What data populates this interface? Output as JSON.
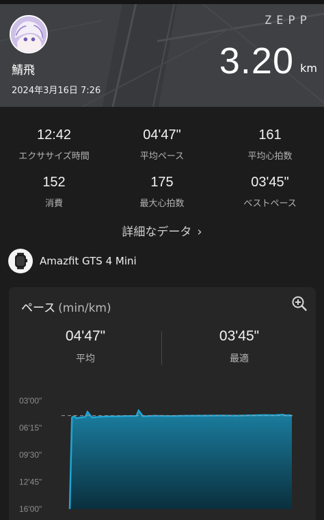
{
  "header": {
    "brand": "ZEPP",
    "username": "鯖飛",
    "datetime": "2024年3月16日 7:26",
    "distance_value": "3.20",
    "distance_unit": "km"
  },
  "stats": [
    {
      "value": "12:42",
      "label": "エクササイズ時間"
    },
    {
      "value": "04'47\"",
      "label": "平均ペース"
    },
    {
      "value": "161",
      "label": "平均心拍数"
    },
    {
      "value": "152",
      "label": "消費"
    },
    {
      "value": "175",
      "label": "最大心拍数"
    },
    {
      "value": "03'45\"",
      "label": "ベストペース"
    }
  ],
  "details_link": "詳細なデータ",
  "device": {
    "name": "Amazfit GTS 4 Mini"
  },
  "pace_card": {
    "title": "ペース",
    "unit": "(min/km)",
    "average_value": "04'47\"",
    "average_label": "平均",
    "best_value": "03'45\"",
    "best_label": "最適"
  },
  "colors": {
    "accent": "#1fa6d6",
    "area_top": "#1b7fa1",
    "area_bottom": "#0a2f3d",
    "background": "#1c1c1c",
    "card": "#262626"
  },
  "icons": [
    "chevron-right-icon",
    "zoom-in-icon",
    "watch-icon",
    "avatar-image"
  ],
  "chart_data": {
    "type": "area",
    "title": "ペース",
    "ylabel": "(min/km)",
    "y_ticks": [
      "03'00\"",
      "06'15\"",
      "09'30\"",
      "12'45\"",
      "16'00\""
    ],
    "y_inverted": true,
    "ylim_seconds": [
      180,
      960
    ],
    "average_line_seconds": 287,
    "x": [
      0.0,
      0.01,
      0.02,
      0.03,
      0.05,
      0.07,
      0.08,
      0.1,
      0.14,
      0.18,
      0.22,
      0.25,
      0.3,
      0.31,
      0.33,
      0.38,
      0.45,
      0.52,
      0.6,
      0.68,
      0.75,
      0.82,
      0.88,
      0.92,
      0.96,
      0.97,
      0.99,
      1.0
    ],
    "y_seconds": [
      960,
      300,
      290,
      305,
      300,
      296,
      260,
      300,
      295,
      292,
      292,
      290,
      290,
      250,
      292,
      288,
      290,
      288,
      287,
      286,
      287,
      285,
      283,
      284,
      280,
      285,
      284,
      287
    ]
  }
}
